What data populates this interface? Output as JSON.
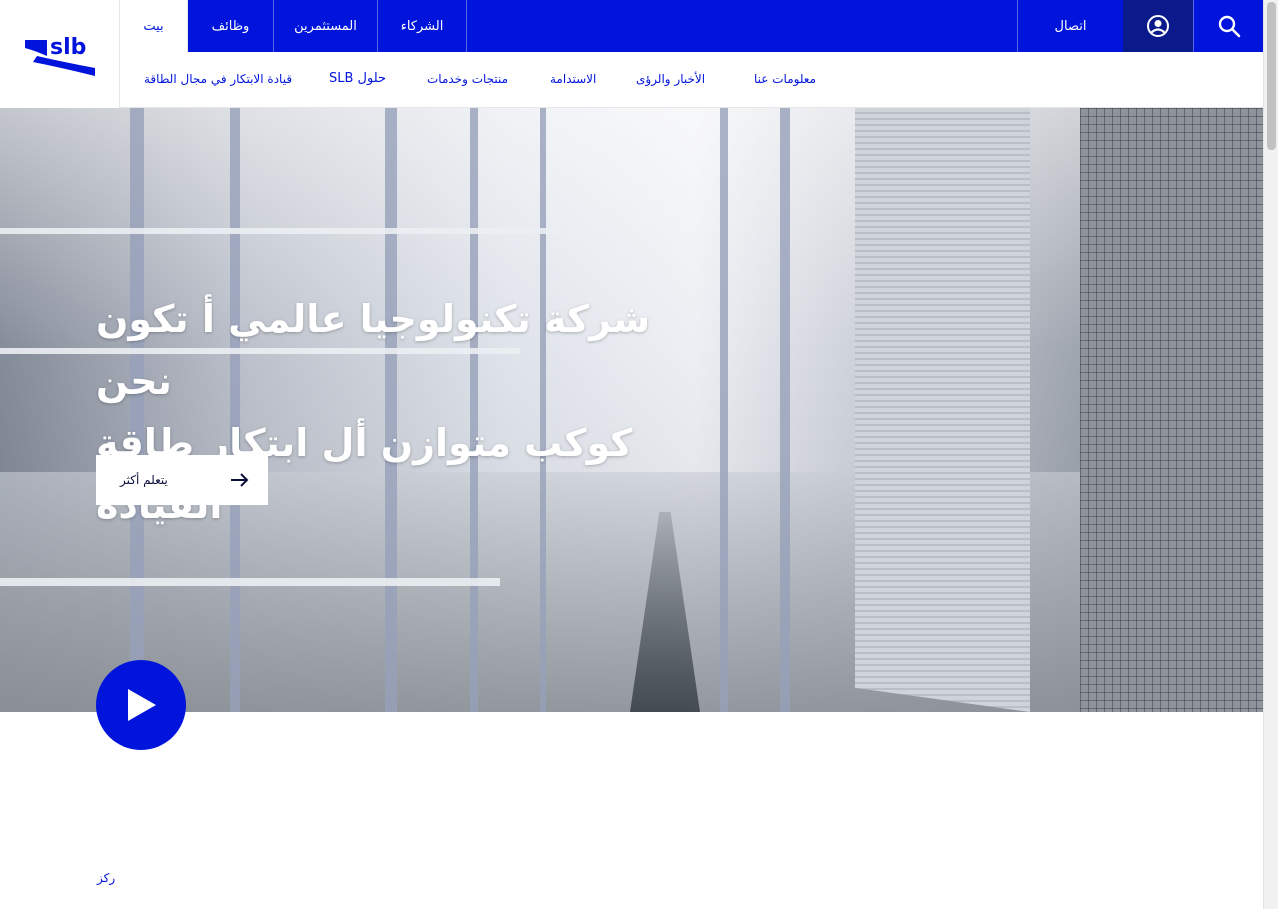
{
  "brand": {
    "logo_text": "slb",
    "accent_color": "#0014dc",
    "dark_accent": "#0a1a8a"
  },
  "topbar": {
    "tabs": [
      {
        "label": "بيت",
        "active": true
      },
      {
        "label": "وظائف",
        "active": false
      },
      {
        "label": "المستثمرين",
        "active": false
      },
      {
        "label": "الشركاء",
        "active": false
      }
    ],
    "contact_label": "اتصال",
    "user_icon": "user-circle-icon",
    "search_icon": "search-icon"
  },
  "subnav": {
    "items": [
      "معلومات عنا",
      "الأخبار والرؤى",
      "الاستدامة",
      "منتجات وخدمات",
      "SLB حلول",
      "قيادة الابتكار في مجال الطاقة"
    ]
  },
  "hero": {
    "title_line1": "شركة تكنولوجيا عالمي أ تكون نحن",
    "title_line2": "كوكب متوازن أل ابتكار طاقة القيادة",
    "cta_label": "يتعلم أكثر",
    "cta_icon": "arrow-right-icon",
    "play_icon": "play-icon"
  },
  "section": {
    "focus_label": "ركز"
  }
}
